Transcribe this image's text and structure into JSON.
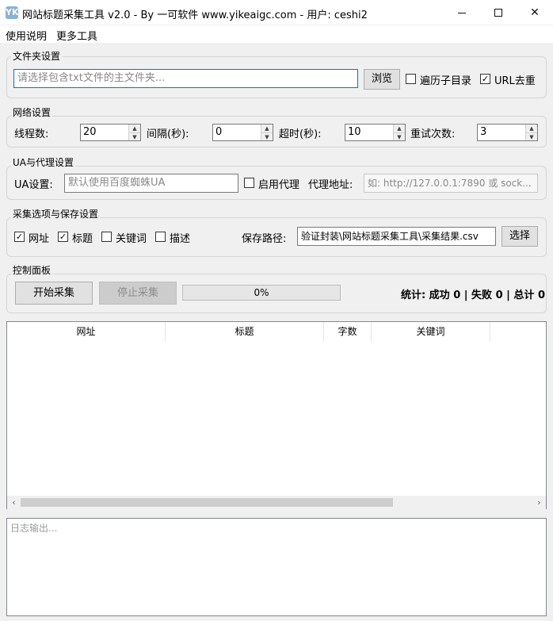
{
  "window": {
    "title": "网站标题采集工具 v2.0 - By 一可软件 www.yikeaigc.com - 用户: ceshi2",
    "app_icon": "YK",
    "min_icon": "minimize-icon",
    "max_icon": "maximize-icon",
    "close_glyph": "✕"
  },
  "menu": {
    "items": [
      "使用说明",
      "更多工具"
    ]
  },
  "folder_group": {
    "title": "文件夹设置",
    "path_placeholder": "请选择包含txt文件的主文件夹...",
    "browse_label": "浏览",
    "recursive_label": "遍历子目录",
    "recursive_checked": false,
    "dedupe_label": "URL去重",
    "dedupe_checked": true
  },
  "network_group": {
    "title": "网络设置",
    "threads_label": "线程数:",
    "threads_value": "20",
    "interval_label": "间隔(秒):",
    "interval_value": "0",
    "timeout_label": "超时(秒):",
    "timeout_value": "10",
    "retry_label": "重试次数:",
    "retry_value": "3"
  },
  "ua_group": {
    "title": "UA与代理设置",
    "ua_label": "UA设置:",
    "ua_placeholder": "默认使用百度蜘蛛UA",
    "proxy_enable_label": "启用代理",
    "proxy_enable_checked": false,
    "proxy_addr_label": "代理地址:",
    "proxy_placeholder": "如: http://127.0.0.1:7890 或 sock..."
  },
  "collect_group": {
    "title": "采集选项与保存设置",
    "options": [
      {
        "label": "网址",
        "checked": true
      },
      {
        "label": "标题",
        "checked": true
      },
      {
        "label": "关键词",
        "checked": false
      },
      {
        "label": "描述",
        "checked": false
      }
    ],
    "save_path_label": "保存路径:",
    "save_path_value": "验证封装\\网站标题采集工具\\采集结果.csv",
    "choose_label": "选择"
  },
  "control_group": {
    "title": "控制面板",
    "start_label": "开始采集",
    "stop_label": "停止采集",
    "progress_value": 0,
    "progress_text": "0%",
    "stats_text": "统计: 成功 0 | 失败 0 | 总计 0"
  },
  "table": {
    "columns": [
      "网址",
      "标题",
      "字数",
      "关键词"
    ],
    "scroll_left": "‹",
    "scroll_right": "›"
  },
  "log": {
    "placeholder": "日志输出..."
  }
}
